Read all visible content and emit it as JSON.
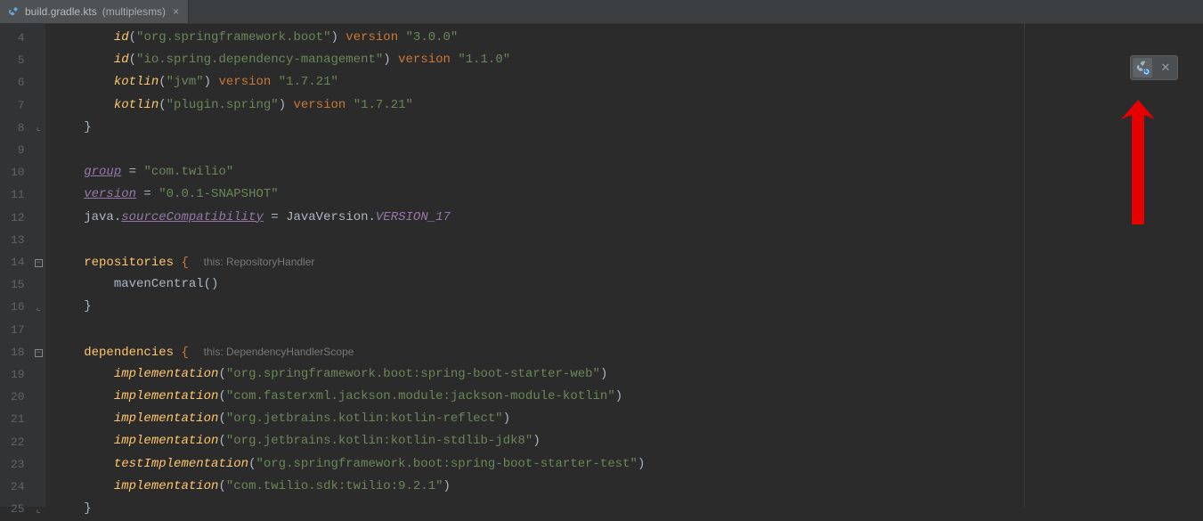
{
  "tab": {
    "filename": "build.gradle.kts",
    "context": "(multiplesms)"
  },
  "toolbar": {
    "refresh_icon": "gradle-refresh",
    "close_icon": "close"
  },
  "gutter": {
    "start": 4,
    "end": 25
  },
  "code": {
    "lines": [
      {
        "n": 4,
        "tokens": [
          [
            "sp",
            "        "
          ],
          [
            "fn",
            "id"
          ],
          [
            "punct",
            "("
          ],
          [
            "str",
            "\"org.springframework.boot\""
          ],
          [
            "punct",
            ") "
          ],
          [
            "kw",
            "version"
          ],
          [
            "punct",
            " "
          ],
          [
            "str",
            "\"3.0.0\""
          ]
        ]
      },
      {
        "n": 5,
        "tokens": [
          [
            "sp",
            "        "
          ],
          [
            "fn",
            "id"
          ],
          [
            "punct",
            "("
          ],
          [
            "str",
            "\"io.spring.dependency-management\""
          ],
          [
            "punct",
            ") "
          ],
          [
            "kw",
            "version"
          ],
          [
            "punct",
            " "
          ],
          [
            "str",
            "\"1.1.0\""
          ]
        ]
      },
      {
        "n": 6,
        "tokens": [
          [
            "sp",
            "        "
          ],
          [
            "fn",
            "kotlin"
          ],
          [
            "punct",
            "("
          ],
          [
            "str",
            "\"jvm\""
          ],
          [
            "punct",
            ") "
          ],
          [
            "kw",
            "version"
          ],
          [
            "punct",
            " "
          ],
          [
            "str",
            "\"1.7.21\""
          ]
        ]
      },
      {
        "n": 7,
        "tokens": [
          [
            "sp",
            "        "
          ],
          [
            "fn",
            "kotlin"
          ],
          [
            "punct",
            "("
          ],
          [
            "str",
            "\"plugin.spring\""
          ],
          [
            "punct",
            ") "
          ],
          [
            "kw",
            "version"
          ],
          [
            "punct",
            " "
          ],
          [
            "str",
            "\"1.7.21\""
          ]
        ]
      },
      {
        "n": 8,
        "fold": "close",
        "tokens": [
          [
            "sp",
            "    "
          ],
          [
            "punct",
            "}"
          ]
        ]
      },
      {
        "n": 9,
        "tokens": []
      },
      {
        "n": 10,
        "tokens": [
          [
            "sp",
            "    "
          ],
          [
            "prop-u",
            "group"
          ],
          [
            "punct",
            " = "
          ],
          [
            "str",
            "\"com.twilio\""
          ]
        ]
      },
      {
        "n": 11,
        "tokens": [
          [
            "sp",
            "    "
          ],
          [
            "prop-u",
            "version"
          ],
          [
            "punct",
            " = "
          ],
          [
            "str",
            "\"0.0.1-SNAPSHOT\""
          ]
        ]
      },
      {
        "n": 12,
        "tokens": [
          [
            "sp",
            "    "
          ],
          [
            "ident",
            "java"
          ],
          [
            "punct",
            "."
          ],
          [
            "prop-u",
            "sourceCompatibility"
          ],
          [
            "punct",
            " = JavaVersion."
          ],
          [
            "const",
            "VERSION_17"
          ]
        ]
      },
      {
        "n": 13,
        "tokens": []
      },
      {
        "n": 14,
        "fold": "open",
        "tokens": [
          [
            "sp",
            "    "
          ],
          [
            "fn-ni",
            "repositories"
          ],
          [
            "punct",
            " "
          ],
          [
            "kw",
            "{"
          ],
          [
            "sp",
            "  "
          ],
          [
            "hint",
            "this: RepositoryHandler"
          ]
        ]
      },
      {
        "n": 15,
        "tokens": [
          [
            "sp",
            "        "
          ],
          [
            "ident",
            "mavenCentral"
          ],
          [
            "punct",
            "()"
          ]
        ]
      },
      {
        "n": 16,
        "fold": "close",
        "tokens": [
          [
            "sp",
            "    "
          ],
          [
            "punct",
            "}"
          ]
        ]
      },
      {
        "n": 17,
        "tokens": []
      },
      {
        "n": 18,
        "fold": "open",
        "tokens": [
          [
            "sp",
            "    "
          ],
          [
            "fn-ni",
            "dependencies"
          ],
          [
            "punct",
            " "
          ],
          [
            "kw",
            "{"
          ],
          [
            "sp",
            "  "
          ],
          [
            "hint",
            "this: DependencyHandlerScope"
          ]
        ]
      },
      {
        "n": 19,
        "tokens": [
          [
            "sp",
            "        "
          ],
          [
            "fn",
            "implementation"
          ],
          [
            "punct",
            "("
          ],
          [
            "str",
            "\"org.springframework.boot:spring-boot-starter-web\""
          ],
          [
            "punct",
            ")"
          ]
        ]
      },
      {
        "n": 20,
        "tokens": [
          [
            "sp",
            "        "
          ],
          [
            "fn",
            "implementation"
          ],
          [
            "punct",
            "("
          ],
          [
            "str",
            "\"com.fasterxml.jackson.module:jackson-module-kotlin\""
          ],
          [
            "punct",
            ")"
          ]
        ]
      },
      {
        "n": 21,
        "tokens": [
          [
            "sp",
            "        "
          ],
          [
            "fn",
            "implementation"
          ],
          [
            "punct",
            "("
          ],
          [
            "str",
            "\"org.jetbrains.kotlin:kotlin-reflect\""
          ],
          [
            "punct",
            ")"
          ]
        ]
      },
      {
        "n": 22,
        "tokens": [
          [
            "sp",
            "        "
          ],
          [
            "fn",
            "implementation"
          ],
          [
            "punct",
            "("
          ],
          [
            "str",
            "\"org.jetbrains.kotlin:kotlin-stdlib-jdk8\""
          ],
          [
            "punct",
            ")"
          ]
        ]
      },
      {
        "n": 23,
        "tokens": [
          [
            "sp",
            "        "
          ],
          [
            "fn",
            "testImplementation"
          ],
          [
            "punct",
            "("
          ],
          [
            "str",
            "\"org.springframework.boot:spring-boot-starter-test\""
          ],
          [
            "punct",
            ")"
          ]
        ]
      },
      {
        "n": 24,
        "tokens": [
          [
            "sp",
            "        "
          ],
          [
            "fn",
            "implementation"
          ],
          [
            "punct",
            "("
          ],
          [
            "str",
            "\"com.twilio.sdk:twilio:9.2.1\""
          ],
          [
            "punct",
            ")"
          ]
        ]
      },
      {
        "n": 25,
        "fold": "close",
        "tokens": [
          [
            "sp",
            "    "
          ],
          [
            "punct",
            "}"
          ]
        ]
      }
    ]
  },
  "annotation": {
    "arrow_color": "#e60000"
  }
}
